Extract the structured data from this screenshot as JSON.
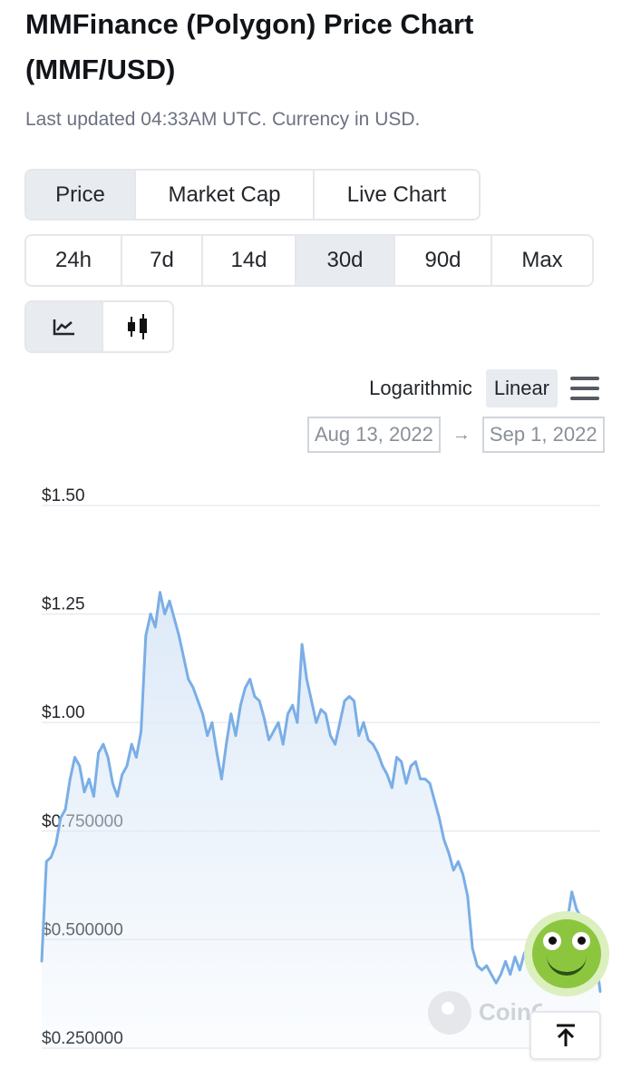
{
  "header": {
    "title": "MMFinance (Polygon) Price Chart (MMF/USD)",
    "subtitle": "Last updated 04:33AM UTC. Currency in USD."
  },
  "tabs": [
    {
      "label": "Price",
      "active": true
    },
    {
      "label": "Market Cap",
      "active": false
    },
    {
      "label": "Live Chart",
      "active": false
    }
  ],
  "ranges": [
    {
      "label": "24h",
      "active": false
    },
    {
      "label": "7d",
      "active": false
    },
    {
      "label": "14d",
      "active": false
    },
    {
      "label": "30d",
      "active": true
    },
    {
      "label": "90d",
      "active": false
    },
    {
      "label": "Max",
      "active": false
    }
  ],
  "chart_types": [
    {
      "icon": "line-chart-icon",
      "active": true
    },
    {
      "icon": "candlestick-icon",
      "active": false
    }
  ],
  "scale": {
    "log_label": "Logarithmic",
    "linear_label": "Linear",
    "selected": "Linear"
  },
  "menu_icon": "hamburger-menu-icon",
  "date_range": {
    "from": "Aug 13, 2022",
    "arrow": "→",
    "to": "Sep 1, 2022"
  },
  "watermark": {
    "text": "CoinGecko"
  },
  "scroll_top_icon": "arrow-up-icon",
  "colors": {
    "line": "#7aaee6",
    "fill_top": "#dce9f8",
    "active_bg": "#e8ebf0",
    "border": "#e5e7eb",
    "grid": "#e8ebf0"
  },
  "chart_data": {
    "type": "area",
    "y_ticks": [
      {
        "value": 1.5,
        "label": "$1.50"
      },
      {
        "value": 1.25,
        "label": "$1.25"
      },
      {
        "value": 1.0,
        "label": "$1.00"
      },
      {
        "value": 0.75,
        "label": "$0.750000"
      },
      {
        "value": 0.5,
        "label": "$0.500000"
      },
      {
        "value": 0.25,
        "label": "$0.250000"
      }
    ],
    "ylim": [
      0.25,
      1.5
    ],
    "grid": true,
    "x_range": [
      "Aug 13, 2022",
      "Sep 1, 2022"
    ],
    "series": [
      {
        "values": [
          0.45,
          0.68,
          0.69,
          0.72,
          0.78,
          0.8,
          0.87,
          0.92,
          0.9,
          0.84,
          0.87,
          0.83,
          0.93,
          0.95,
          0.92,
          0.86,
          0.83,
          0.88,
          0.9,
          0.95,
          0.92,
          0.98,
          1.2,
          1.25,
          1.22,
          1.3,
          1.25,
          1.28,
          1.24,
          1.2,
          1.15,
          1.1,
          1.08,
          1.05,
          1.02,
          0.97,
          1.0,
          0.93,
          0.87,
          0.95,
          1.02,
          0.97,
          1.04,
          1.08,
          1.1,
          1.06,
          1.05,
          1.01,
          0.96,
          0.98,
          1.0,
          0.95,
          1.02,
          1.04,
          1.0,
          1.18,
          1.1,
          1.05,
          1.0,
          1.03,
          1.02,
          0.97,
          0.95,
          1.0,
          1.05,
          1.06,
          1.05,
          0.97,
          1.0,
          0.96,
          0.95,
          0.93,
          0.9,
          0.88,
          0.85,
          0.92,
          0.91,
          0.86,
          0.9,
          0.91,
          0.87,
          0.87,
          0.86,
          0.82,
          0.78,
          0.73,
          0.7,
          0.66,
          0.68,
          0.65,
          0.6,
          0.48,
          0.44,
          0.43,
          0.44,
          0.42,
          0.4,
          0.42,
          0.45,
          0.42,
          0.46,
          0.43,
          0.47,
          0.46,
          0.45,
          0.44,
          0.47,
          0.49,
          0.51,
          0.53,
          0.55,
          0.54,
          0.61,
          0.57,
          0.55,
          0.52,
          0.54,
          0.47,
          0.38
        ]
      }
    ]
  }
}
